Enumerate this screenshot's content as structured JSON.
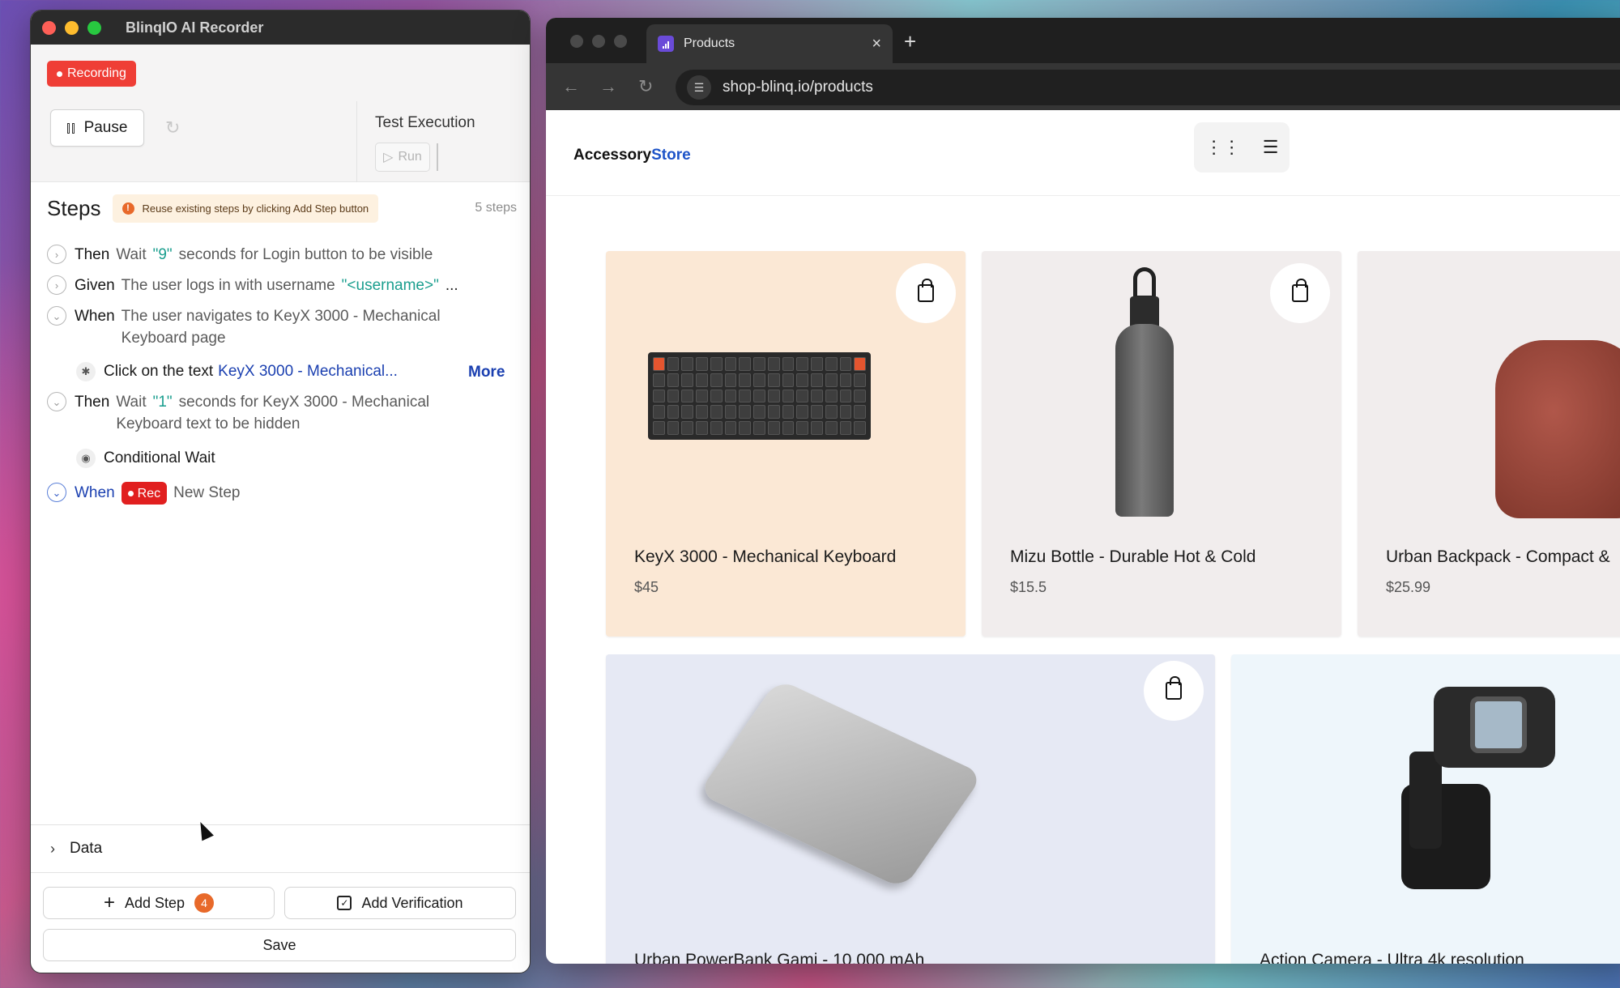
{
  "recorder": {
    "title": "BlinqIO AI Recorder",
    "recording_label": "Recording",
    "pause_label": "Pause",
    "test_execution_label": "Test Execution",
    "run_label": "Run",
    "steps_title": "Steps",
    "reuse_hint": "Reuse existing steps by clicking Add Step button",
    "steps_count": "5 steps",
    "steps": [
      {
        "keyword": "Then",
        "text_a": "Wait",
        "param": "\"9\"",
        "text_b": "seconds for Login button to be visible"
      },
      {
        "keyword": "Given",
        "text_a": "The user logs in with username",
        "param": "\"<username>\"",
        "text_b": "..."
      },
      {
        "keyword": "When",
        "text_a": "The user navigates to KeyX 3000 - Mechanical",
        "text_b": "Keyboard page"
      },
      {
        "keyword": "Then",
        "text_a": "Wait",
        "param": "\"1\"",
        "text_b": "seconds for KeyX 3000 - Mechanical",
        "text_c": "Keyboard text to be hidden"
      },
      {
        "keyword": "When",
        "rec_label": "Rec",
        "text_a": "New Step"
      }
    ],
    "substep_click": {
      "prefix": "Click on the text",
      "target": "KeyX 3000 - Mechanical...",
      "more_label": "More"
    },
    "substep_conditional": "Conditional Wait",
    "data_label": "Data",
    "add_step_label": "Add Step",
    "add_step_badge": "4",
    "add_verification_label": "Add Verification",
    "save_label": "Save"
  },
  "browser": {
    "tab_title": "Products",
    "url": "shop-blinq.io/products",
    "logo_prefix": "Accessory",
    "logo_suffix": "Store",
    "products": [
      {
        "name": "KeyX 3000 - Mechanical Keyboard",
        "price": "$45",
        "bg": "#fbe8d5"
      },
      {
        "name": "Mizu Bottle - Durable Hot & Cold",
        "price": "$15.5",
        "bg": "#f1eded"
      },
      {
        "name": "Urban Backpack - Compact &",
        "price": "$25.99",
        "bg": "#f1eded"
      },
      {
        "name": "Urban PowerBank Gami - 10,000 mAh",
        "bg": "#e6e9f4"
      },
      {
        "name": "Action Camera - Ultra 4k resolution",
        "bg": "#eef6fb"
      }
    ]
  },
  "icons": {
    "pause": "pause-icon",
    "refresh": "refresh-icon",
    "run": "play-icon",
    "warning": "warning-icon",
    "bag": "shopping-bag-icon"
  }
}
